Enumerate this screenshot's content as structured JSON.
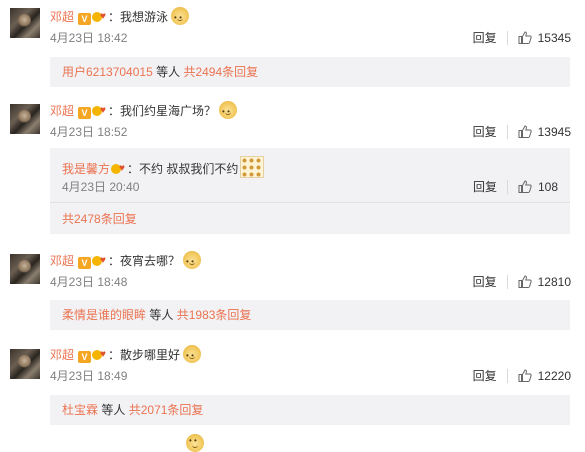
{
  "labels": {
    "reply": "回复",
    "and_others": "等人",
    "colon": "："
  },
  "comments": [
    {
      "user": "邓超",
      "badge": "V",
      "text": "我想游泳",
      "date": "4月23日 18:42",
      "likes": "15345",
      "summary": {
        "user": "用户6213704015",
        "others": "等人",
        "total": "共2494条回复"
      }
    },
    {
      "user": "邓超",
      "badge": "V",
      "text": "我们约星海广场？",
      "date": "4月23日 18:52",
      "likes": "13945",
      "reply": {
        "user": "我是馨方",
        "text": "不约 叔叔我们不约",
        "date": "4月23日 20:40",
        "likes": "108"
      },
      "summary": {
        "total": "共2478条回复"
      }
    },
    {
      "user": "邓超",
      "badge": "V",
      "text": "夜宵去哪？",
      "date": "4月23日 18:48",
      "likes": "12810",
      "summary": {
        "user": "柔情是谁的眼眸",
        "others": "等人",
        "total": "共1983条回复"
      }
    },
    {
      "user": "邓超",
      "badge": "V",
      "text": "散步哪里好",
      "date": "4月23日 18:49",
      "likes": "12220",
      "summary": {
        "user": "杜宝霖",
        "others": "等人",
        "total": "共2071条回复"
      }
    }
  ],
  "icons": {
    "like": "thumbs-up-icon",
    "emoji": "doge-emoji-icon",
    "verified": "verified-v-icon",
    "member": "member-crown-icon"
  },
  "colors": {
    "link": "#eb7350",
    "meta": "#808080",
    "sub_bg": "#f2f2f5"
  }
}
